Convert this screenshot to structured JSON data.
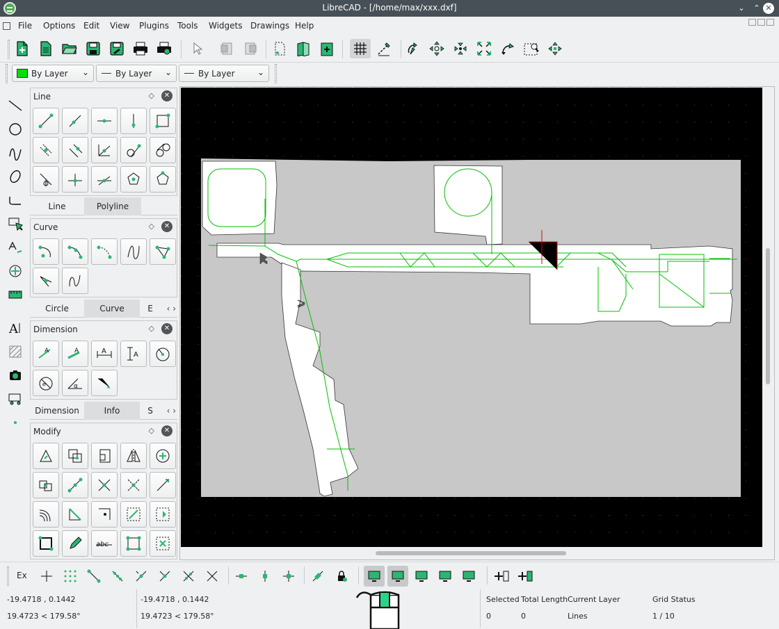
{
  "window": {
    "title": "LibreCAD - [/home/max/xxx.dxf]",
    "buttons": [
      "⌄",
      "⌃",
      "✕"
    ]
  },
  "menubar": {
    "items": [
      "File",
      "Options",
      "Edit",
      "View",
      "Plugins",
      "Tools",
      "Widgets",
      "Drawings",
      "Help"
    ]
  },
  "pen": {
    "color": {
      "label": "By Layer",
      "swatch": "#00e000"
    },
    "width": {
      "label": "By Layer"
    },
    "linetype": {
      "label": "By Layer"
    }
  },
  "docks": {
    "line": {
      "title": "Line",
      "tabs": [
        "Line",
        "Polyline"
      ],
      "selected_tab": "Polyline"
    },
    "curve": {
      "title": "Curve",
      "tabs": [
        "Circle",
        "Curve",
        "E"
      ],
      "selected_tab": "Curve"
    },
    "dimension": {
      "title": "Dimension",
      "tabs": [
        "Dimension",
        "Info",
        "S"
      ],
      "selected_tab": "Info"
    },
    "modify": {
      "title": "Modify"
    }
  },
  "snap": {
    "ex_label": "Ex"
  },
  "status": {
    "abs_coord": "-19.4718 , 0.1442",
    "abs_polar": "19.4723 < 179.58°",
    "rel_coord": "-19.4718 , 0.1442",
    "rel_polar": "19.4723 < 179.58°",
    "selected_label": "Selected",
    "selected_value": "0",
    "total_length_label": "Total Length",
    "total_length_value": "0",
    "current_layer_label": "Current Layer",
    "current_layer_value": "Lines",
    "grid_status_label": "Grid Status",
    "grid_status_value": "1 / 10"
  },
  "colors": {
    "accent": "#00a651",
    "drawing_line": "#00c000",
    "canvas_bg": "#000000",
    "map_gray": "#c8c8c8",
    "crosshair": "#e00000"
  }
}
